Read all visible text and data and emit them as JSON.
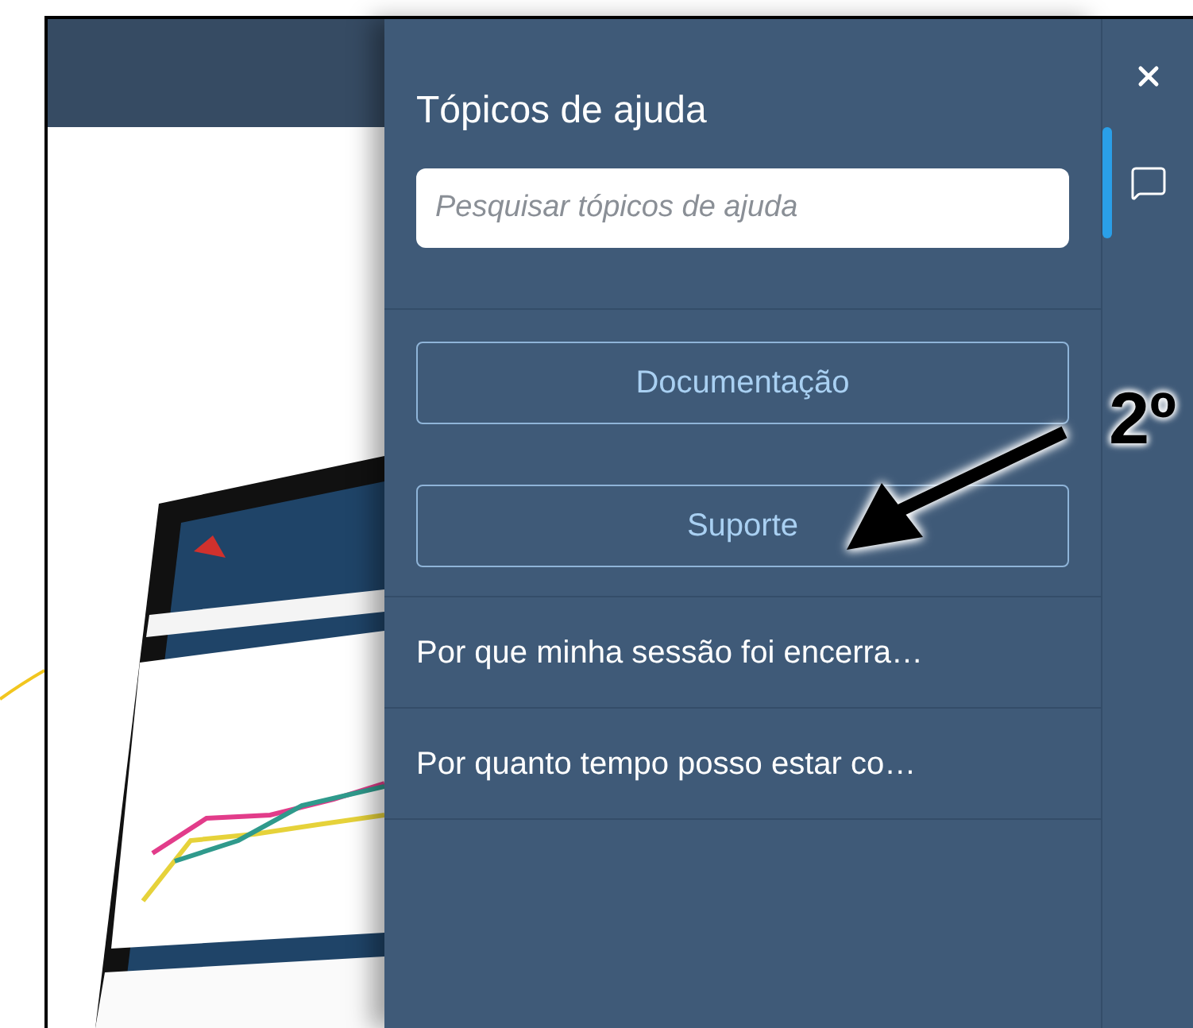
{
  "help_panel": {
    "title": "Tópicos de ajuda",
    "search": {
      "placeholder": "Pesquisar tópicos de ajuda"
    },
    "buttons": [
      "Documentação",
      "Suporte"
    ],
    "topics": [
      "Por que minha sessão foi encerra…",
      "Por quanto tempo posso estar co…"
    ]
  },
  "side_rail": {
    "items": [
      {
        "kind": "chat",
        "selected": true
      }
    ]
  },
  "annotation": {
    "label": "2º"
  }
}
